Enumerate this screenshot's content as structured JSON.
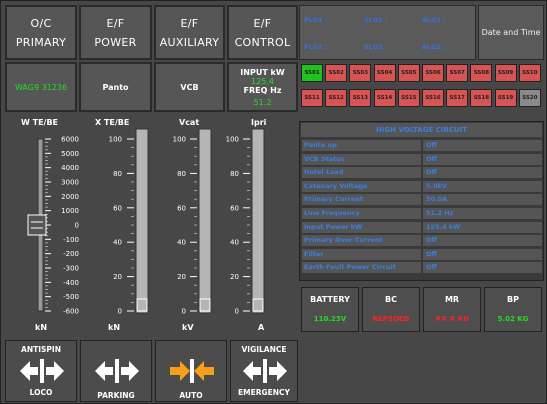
{
  "header_buttons": [
    {
      "line1": "O/C",
      "line2": "PRIMARY"
    },
    {
      "line1": "E/F",
      "line2": "POWER"
    },
    {
      "line1": "E/F",
      "line2": "AUXILIARY"
    },
    {
      "line1": "E/F",
      "line2": "CONTROL"
    }
  ],
  "info_row": {
    "loco_id": "WAG9 31236",
    "panto": "Panto",
    "vcb": "VCB",
    "input_kw_label": "INPUT kW",
    "input_kw_value": "125.4",
    "freq_label": "FREQ Hz",
    "freq_value": "51.2"
  },
  "flags": {
    "flg1": "FLG1 :",
    "slg1": "SLG1 :",
    "alg1": "ALG1 :",
    "flg2": "FLG2 :",
    "slg2": "SLG2 :",
    "alg2": "ALG2 :"
  },
  "date_time": "Date and Time",
  "ss_buttons_row1": [
    "SS01",
    "SS02",
    "SS03",
    "SS04",
    "SS05",
    "SS06",
    "SS07",
    "SS08",
    "SS09",
    "SS10"
  ],
  "ss_buttons_row2": [
    "SS11",
    "SS12",
    "SS13",
    "SS14",
    "SS15",
    "SS16",
    "SS17",
    "SS18",
    "SS19",
    "SS20"
  ],
  "ss_colors": {
    "active": "#1fc21f",
    "alarm": "#d85454",
    "inactive": "#8a8a8a"
  },
  "gauges": {
    "te": {
      "title": "W TE/BE",
      "unit": "kN",
      "ticks": [
        "6000",
        "5000",
        "4000",
        "3000",
        "2000",
        "1000",
        "0",
        "-100",
        "-200",
        "-300",
        "-400",
        "-500",
        "-600"
      ],
      "level": 0.5
    },
    "xte": {
      "title": "X TE/BE",
      "unit": "kN",
      "ticks": [
        "100",
        "80",
        "60",
        "40",
        "20",
        "0"
      ],
      "level": 0.0
    },
    "vcat": {
      "title": "Vcat",
      "unit": "kV",
      "ticks": [
        "100",
        "80",
        "60",
        "40",
        "20",
        "0"
      ],
      "level": 0.0
    },
    "ipri": {
      "title": "Ipri",
      "unit": "A",
      "ticks": [
        "100",
        "80",
        "60",
        "40",
        "20",
        "0"
      ],
      "level": 0.0
    }
  },
  "hv_circuit": {
    "title": "HIGH VOLTAGE CIRCUIT",
    "rows": [
      {
        "label": "Panto up",
        "value": "Off"
      },
      {
        "label": "VCB Status",
        "value": "Off"
      },
      {
        "label": "Hotel Load",
        "value": "Off"
      },
      {
        "label": "Catenary Voltage",
        "value": "5.0kV"
      },
      {
        "label": "Primary Current",
        "value": "50.0A"
      },
      {
        "label": "Line Frequency",
        "value": "51.2 Hz"
      },
      {
        "label": "Input Power kW",
        "value": "125.4 kW"
      },
      {
        "label": "Primary Over Current",
        "value": "Off"
      },
      {
        "label": "Filter",
        "value": "Off"
      },
      {
        "label": "Earth Fault Power Circuit",
        "value": "Off"
      }
    ]
  },
  "status": [
    {
      "label": "BATTERY",
      "value": "110.23V",
      "color": "#22dd22"
    },
    {
      "label": "BC",
      "value": "REPSDED",
      "color": "#ff2222"
    },
    {
      "label": "MR",
      "value": "##.# KG",
      "color": "#ff2222"
    },
    {
      "label": "BP",
      "value": "5.02 KG",
      "color": "#22dd22"
    }
  ],
  "controls": [
    {
      "top": "ANTISPIN",
      "bottom": "LOCO"
    },
    {
      "top": "",
      "bottom": "PARKING"
    },
    {
      "top": "",
      "bottom": "AUTO"
    },
    {
      "top": "VIGILANCE",
      "bottom": "EMERGENCY"
    }
  ]
}
